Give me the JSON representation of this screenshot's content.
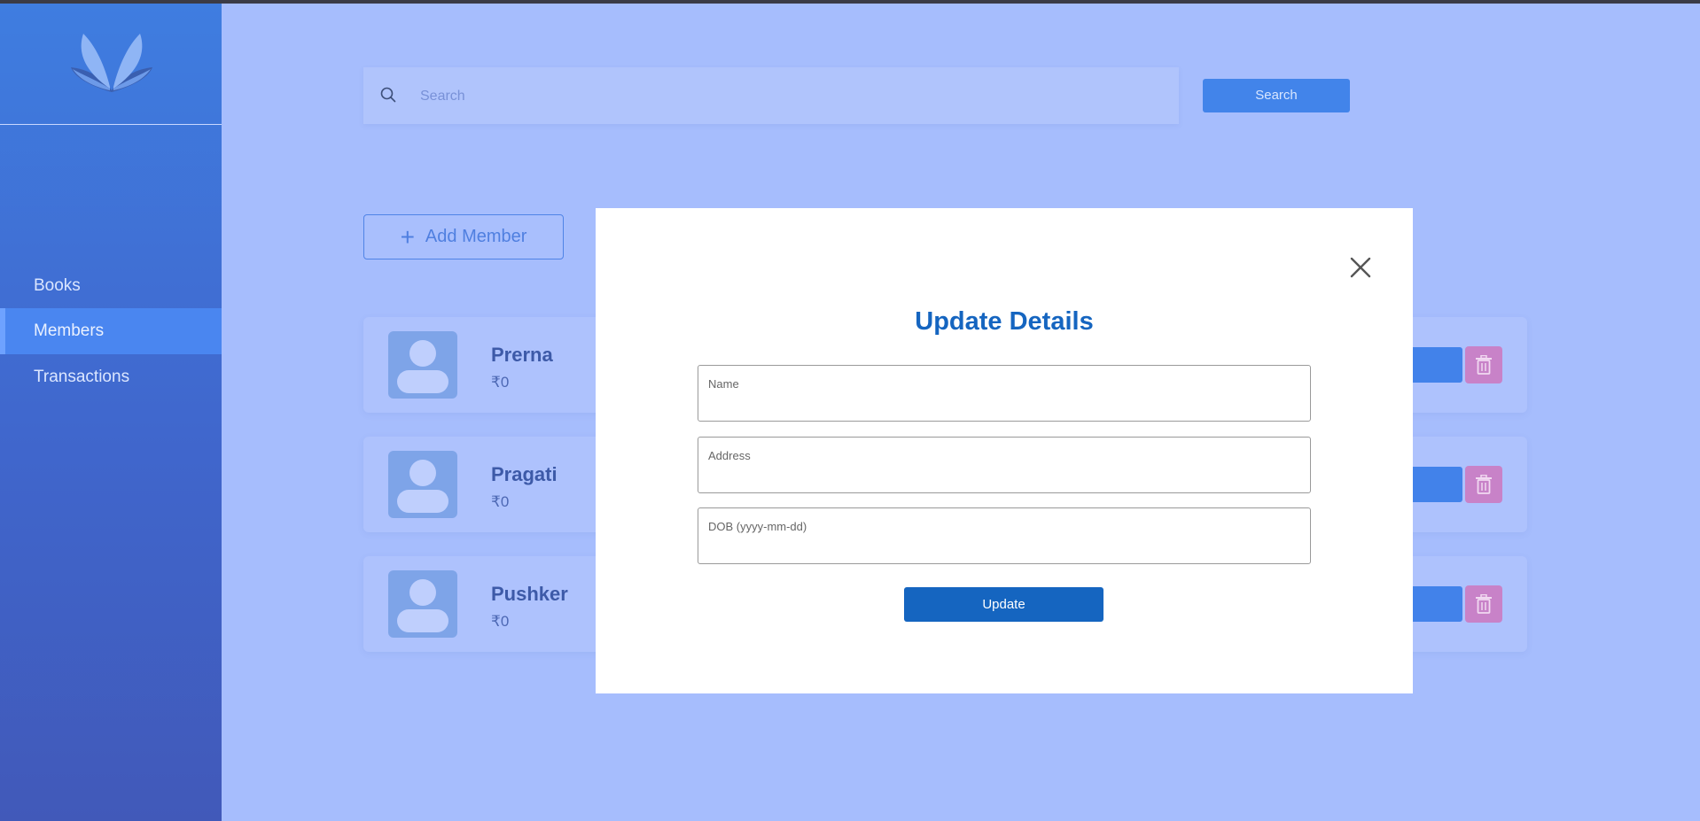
{
  "sidebar": {
    "logo": "open-book-logo",
    "items": [
      {
        "label": "Books",
        "active": false
      },
      {
        "label": "Members",
        "active": true
      },
      {
        "label": "Transactions",
        "active": false
      }
    ]
  },
  "search": {
    "placeholder": "Search",
    "icon": "search-icon",
    "button_label": "Search"
  },
  "add_member": {
    "label": "Add Member",
    "icon": "plus-icon"
  },
  "members": [
    {
      "name": "Prerna",
      "amount": "₹0"
    },
    {
      "name": "Pragati",
      "amount": "₹0"
    },
    {
      "name": "Pushker",
      "amount": "₹0"
    }
  ],
  "modal": {
    "title": "Update Details",
    "close_icon": "close-icon",
    "fields": [
      {
        "label": "Name",
        "value": ""
      },
      {
        "label": "Address",
        "value": ""
      },
      {
        "label": "DOB (yyyy-mm-dd)",
        "value": ""
      }
    ],
    "submit_label": "Update"
  },
  "colors": {
    "accent": "#1565c0",
    "sidebar": "#3f7de0",
    "overlay_background": "#a6bdfd",
    "delete": "#c882c8"
  }
}
